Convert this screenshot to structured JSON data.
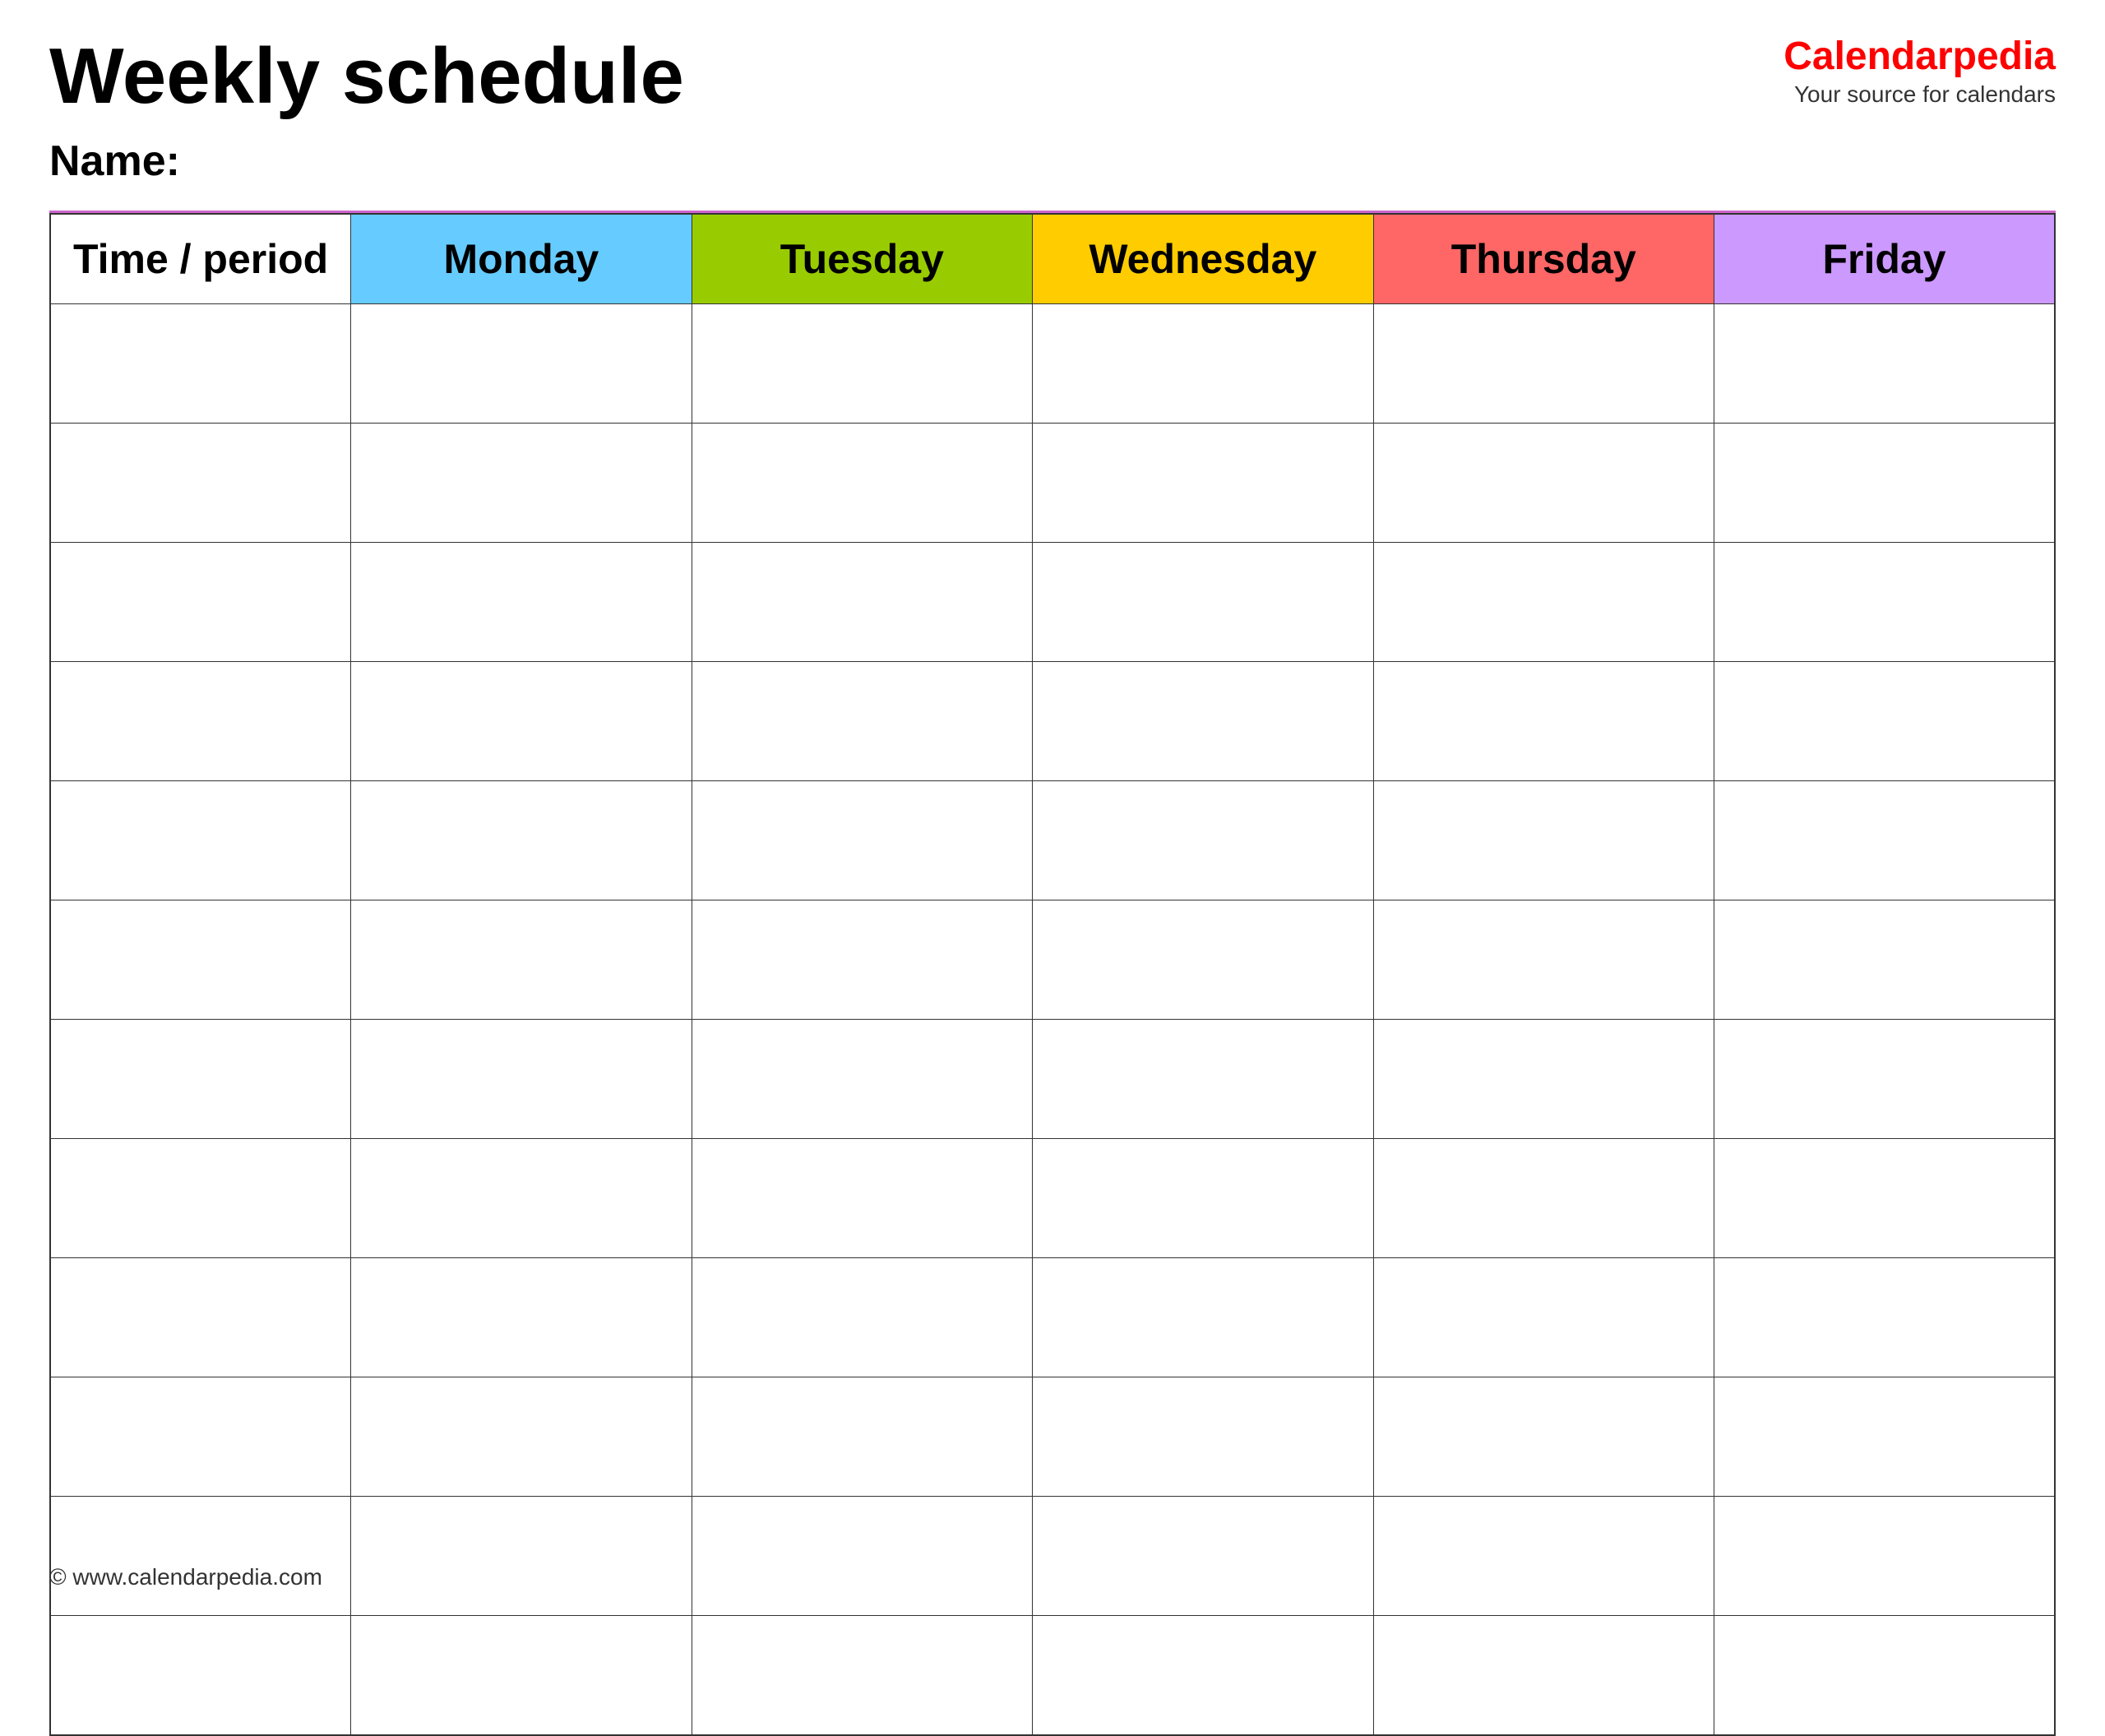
{
  "header": {
    "title": "Weekly schedule",
    "brand_name": "Calendar",
    "brand_name_suffix": "pedia",
    "brand_tagline": "Your source for calendars"
  },
  "name_label": "Name:",
  "columns": [
    {
      "id": "time",
      "label": "Time / period",
      "color": "#ffffff"
    },
    {
      "id": "monday",
      "label": "Monday",
      "color": "#66ccff"
    },
    {
      "id": "tuesday",
      "label": "Tuesday",
      "color": "#99cc00"
    },
    {
      "id": "wednesday",
      "label": "Wednesday",
      "color": "#ffcc00"
    },
    {
      "id": "thursday",
      "label": "Thursday",
      "color": "#ff6666"
    },
    {
      "id": "friday",
      "label": "Friday",
      "color": "#cc99ff"
    }
  ],
  "row_count": 12,
  "footer": "© www.calendarpedia.com"
}
